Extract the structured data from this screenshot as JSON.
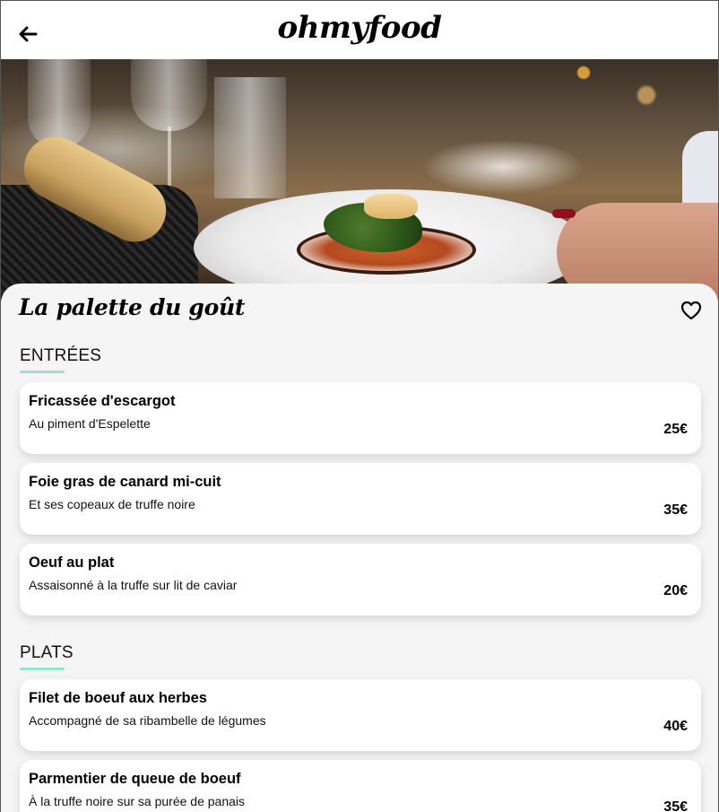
{
  "app": {
    "logo": "ohmyfood"
  },
  "restaurant": {
    "name": "La palette du goût"
  },
  "sections": [
    {
      "title": "ENTRÉES",
      "items": [
        {
          "name": "Fricassée d'escargot",
          "description": "Au piment d'Espelette",
          "price": "25€"
        },
        {
          "name": "Foie gras de canard mi-cuit",
          "description": "Et ses copeaux de truffe noire",
          "price": "35€"
        },
        {
          "name": "Oeuf au plat",
          "description": "Assaisonné à la truffe sur lit de caviar",
          "price": "20€"
        }
      ]
    },
    {
      "title": "PLATS",
      "items": [
        {
          "name": "Filet de boeuf aux herbes",
          "description": "Accompagné de sa ribambelle de légumes",
          "price": "40€"
        },
        {
          "name": "Parmentier de queue de boeuf",
          "description": "À la truffe noire sur sa purée de panais",
          "price": "35€"
        }
      ]
    }
  ],
  "icons": {
    "back": "arrow-left-icon",
    "favorite": "heart-icon"
  },
  "colors": {
    "accent": "#99e2d0",
    "sheet_background": "#f5f5f5",
    "card_background": "#ffffff"
  }
}
